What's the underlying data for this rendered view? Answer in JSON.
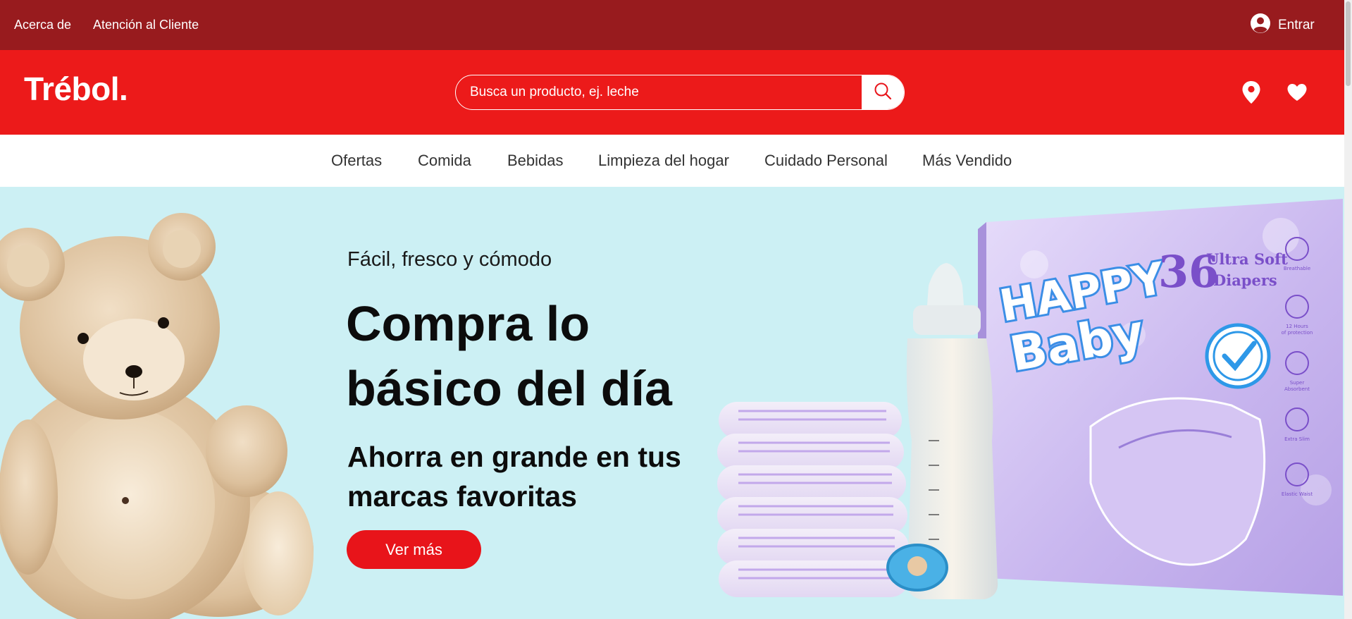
{
  "topbar": {
    "about": "Acerca de",
    "support": "Atención al Cliente",
    "login": "Entrar"
  },
  "header": {
    "logo": "Trébol.",
    "search_placeholder": "Busca un producto, ej. leche"
  },
  "nav": {
    "items": [
      {
        "label": "Ofertas"
      },
      {
        "label": "Comida"
      },
      {
        "label": "Bebidas"
      },
      {
        "label": "Limpieza del hogar"
      },
      {
        "label": "Cuidado Personal"
      },
      {
        "label": "Más Vendido"
      }
    ]
  },
  "hero": {
    "kicker": "Fácil, fresco y cómodo",
    "title": "Compra lo básico del día",
    "subtitle": "Ahorra en grande en tus marcas favoritas",
    "cta": "Ver más",
    "product_pack": {
      "brand": "Happy Baby",
      "count": "36",
      "line1": "Ultra Soft",
      "line2": "Diapers",
      "features": [
        "Breathable",
        "12 Hours of protection",
        "Super Absorbent",
        "Extra Slim",
        "Elastic Waist"
      ]
    }
  },
  "colors": {
    "topbar": "#981b1e",
    "header": "#ec1a1a",
    "hero_bg": "#ccf0f4",
    "cta": "#e8141a"
  },
  "icons": {
    "login": "user-circle-icon",
    "search": "search-icon",
    "location": "location-pin-icon",
    "favorites": "heart-icon"
  }
}
